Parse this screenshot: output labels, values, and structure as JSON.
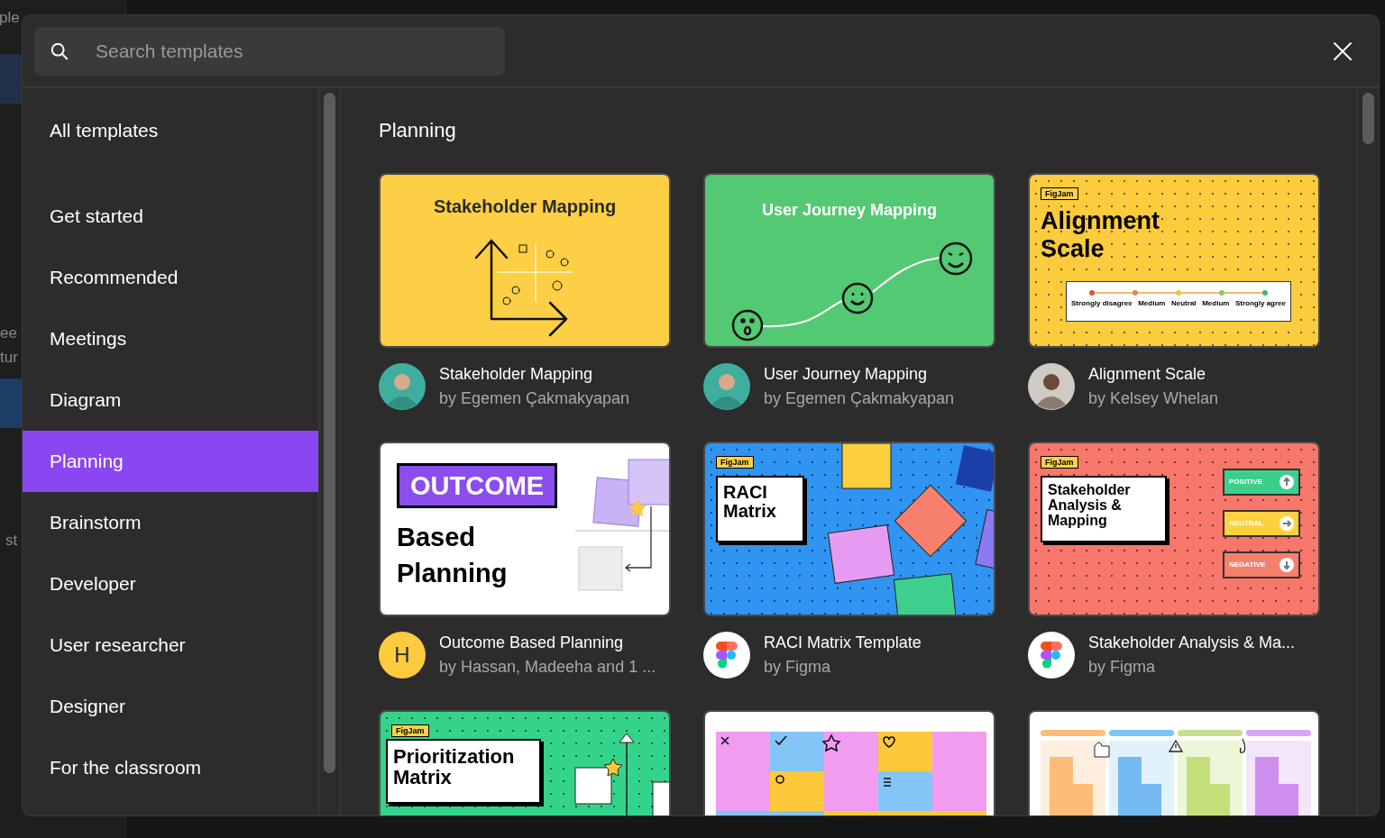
{
  "background": {
    "fragments": [
      "ple",
      "ee",
      "tur",
      "st"
    ]
  },
  "search": {
    "placeholder": "Search templates"
  },
  "sidebar": {
    "items": [
      {
        "label": "All templates",
        "selected": false
      },
      {
        "label": "Get started",
        "selected": false
      },
      {
        "label": "Recommended",
        "selected": false
      },
      {
        "label": "Meetings",
        "selected": false
      },
      {
        "label": "Diagram",
        "selected": false
      },
      {
        "label": "Planning",
        "selected": true
      },
      {
        "label": "Brainstorm",
        "selected": false
      },
      {
        "label": "Developer",
        "selected": false
      },
      {
        "label": "User researcher",
        "selected": false
      },
      {
        "label": "Designer",
        "selected": false
      },
      {
        "label": "For the classroom",
        "selected": false
      }
    ]
  },
  "section": {
    "title": "Planning"
  },
  "templates": [
    {
      "title": "Stakeholder Mapping",
      "author": "by Egemen Çakmakyapan",
      "avatar": {
        "kind": "person"
      },
      "thumb": {
        "kind": "stakeholder",
        "title": "Stakeholder Mapping"
      }
    },
    {
      "title": "User Journey Mapping",
      "author": "by Egemen Çakmakyapan",
      "avatar": {
        "kind": "person"
      },
      "thumb": {
        "kind": "journey",
        "title": "User Journey Mapping"
      }
    },
    {
      "title": "Alignment Scale",
      "author": "by Kelsey Whelan",
      "avatar": {
        "kind": "person-light"
      },
      "thumb": {
        "kind": "alignment",
        "tag": "FigJam",
        "title": "Alignment Scale",
        "labels": [
          "Strongly disagree",
          "Medium",
          "Neutral",
          "Medium",
          "Strongly agree"
        ]
      }
    },
    {
      "title": "Outcome Based Planning",
      "author": "by Hassan, Madeeha and 1 ...",
      "avatar": {
        "kind": "letter",
        "letter": "H"
      },
      "thumb": {
        "kind": "outcome",
        "title": "OUTCOME",
        "subtitle": "Based Planning"
      }
    },
    {
      "title": "RACI Matrix Template",
      "author": "by Figma",
      "avatar": {
        "kind": "figma"
      },
      "thumb": {
        "kind": "raci",
        "tag": "FigJam",
        "title": "RACI Matrix"
      }
    },
    {
      "title": "Stakeholder Analysis & Ma...",
      "author": "by Figma",
      "avatar": {
        "kind": "figma"
      },
      "thumb": {
        "kind": "analysis",
        "tag": "FigJam",
        "title": "Stakeholder Analysis & Mapping",
        "labels": [
          "POSITIVE",
          "NEUTRAL",
          "NEGATIVE"
        ]
      }
    },
    {
      "thumb": {
        "kind": "prioritization",
        "tag": "FigJam",
        "title": "Prioritization Matrix"
      }
    },
    {
      "thumb": {
        "kind": "stickies"
      }
    },
    {
      "thumb": {
        "kind": "board"
      }
    }
  ]
}
